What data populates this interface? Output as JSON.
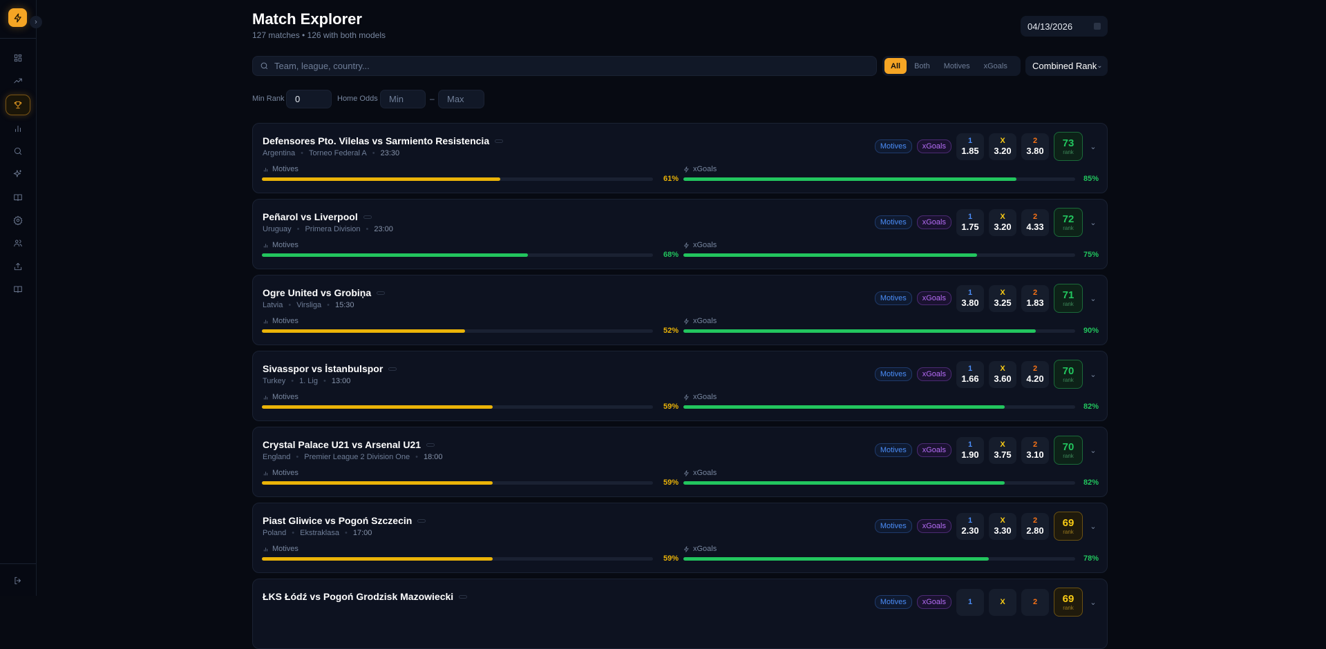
{
  "header": {
    "title": "Match Explorer",
    "subtitle": "127 matches • 126 with both models",
    "date": "04/13/2026"
  },
  "search": {
    "placeholder": "Team, league, country..."
  },
  "filters": {
    "segments": [
      {
        "label": "All",
        "active": true
      },
      {
        "label": "Both"
      },
      {
        "label": "Motives"
      },
      {
        "label": "xGoals"
      }
    ],
    "sort": "Combined Rank",
    "min_rank_label": "Min Rank",
    "min_rank_value": "0",
    "home_odds_label": "Home Odds",
    "min_placeholder": "Min",
    "dash": "–",
    "max_placeholder": "Max"
  },
  "sidebar": {
    "icons": [
      "dashboard-icon",
      "trending-icon",
      "trophy-icon",
      "bar-chart-icon",
      "search-icon",
      "sparkles-icon",
      "book-icon",
      "settings-icon",
      "users-icon",
      "upload-icon",
      "book-open-icon"
    ],
    "active": 2,
    "logout": "logout-icon"
  },
  "labels": {
    "motives": "Motives",
    "xgoals": "xGoals",
    "rank": "rank",
    "home": "1",
    "draw": "X",
    "away": "2"
  },
  "colors": {
    "accent": "#f5a524",
    "green": "#22c55e",
    "yellow": "#eab308",
    "blue": "#4b8df8",
    "orange": "#f97316"
  },
  "matches": [
    {
      "name": "Defensores Pto. Vilelas vs Sarmiento Resistencia",
      "country": "Argentina",
      "league": "Torneo Federal A",
      "time": "23:30",
      "motives": 61,
      "xgoals": 85,
      "odds": [
        "1.85",
        "3.20",
        "3.80"
      ],
      "rank": 73
    },
    {
      "name": "Peñarol vs Liverpool",
      "country": "Uruguay",
      "league": "Primera Division",
      "time": "23:00",
      "motives": 68,
      "xgoals": 75,
      "odds": [
        "1.75",
        "3.20",
        "4.33"
      ],
      "rank": 72
    },
    {
      "name": "Ogre United vs Grobiņa",
      "country": "Latvia",
      "league": "Virsliga",
      "time": "15:30",
      "motives": 52,
      "xgoals": 90,
      "odds": [
        "3.80",
        "3.25",
        "1.83"
      ],
      "rank": 71
    },
    {
      "name": "Sivasspor vs İstanbulspor",
      "country": "Turkey",
      "league": "1. Lig",
      "time": "13:00",
      "motives": 59,
      "xgoals": 82,
      "odds": [
        "1.66",
        "3.60",
        "4.20"
      ],
      "rank": 70
    },
    {
      "name": "Crystal Palace U21 vs Arsenal U21",
      "country": "England",
      "league": "Premier League 2 Division One",
      "time": "18:00",
      "motives": 59,
      "xgoals": 82,
      "odds": [
        "1.90",
        "3.75",
        "3.10"
      ],
      "rank": 70
    },
    {
      "name": "Piast Gliwice vs Pogoń Szczecin",
      "country": "Poland",
      "league": "Ekstraklasa",
      "time": "17:00",
      "motives": 59,
      "xgoals": 78,
      "odds": [
        "2.30",
        "3.30",
        "2.80"
      ],
      "rank": 69
    },
    {
      "name": "ŁKS Łódź vs Pogoń Grodzisk Mazowiecki",
      "country": "",
      "league": "",
      "time": "",
      "motives": null,
      "xgoals": null,
      "odds": [
        "",
        "",
        ""
      ],
      "rank": 69
    }
  ]
}
